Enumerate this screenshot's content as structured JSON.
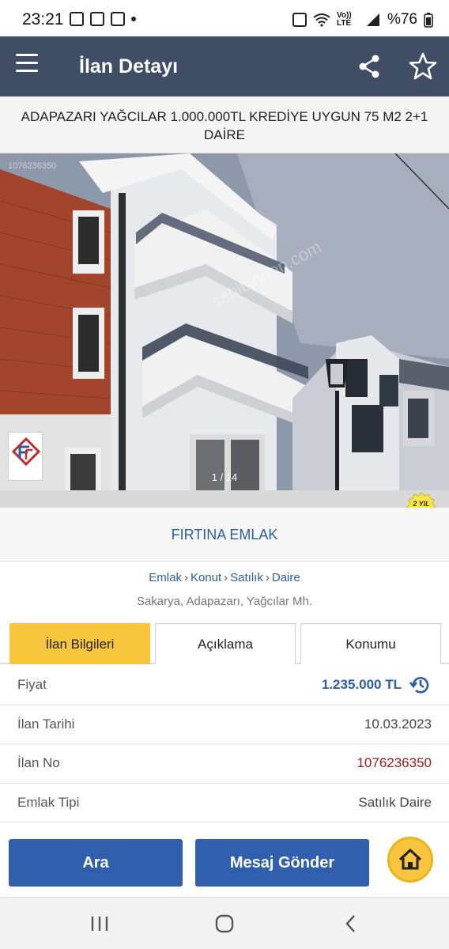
{
  "status_bar": {
    "time": "23:21",
    "battery": "%76",
    "network": "Vo)) LTE"
  },
  "app_bar": {
    "title": "İlan Detayı"
  },
  "listing": {
    "title": "ADAPAZARI YAĞCILAR 1.000.000TL KREDİYE UYGUN 75 M2 2+1 DAİRE",
    "photo_counter": "1 / 14",
    "watermark": "sahibinden.com",
    "image_id_text": "1076236350"
  },
  "badge": {
    "text": "2 YIL"
  },
  "agency": {
    "name": "FIRTINA EMLAK"
  },
  "breadcrumb": [
    "Emlak",
    "Konut",
    "Satılık",
    "Daire"
  ],
  "location": "Sakarya, Adapazarı, Yağcılar Mh.",
  "tabs": [
    {
      "label": "İlan Bilgileri",
      "active": true
    },
    {
      "label": "Açıklama",
      "active": false
    },
    {
      "label": "Konumu",
      "active": false
    }
  ],
  "info": [
    {
      "key": "Fiyat",
      "value": "1.235.000 TL"
    },
    {
      "key": "İlan Tarihi",
      "value": "10.03.2023"
    },
    {
      "key": "İlan No",
      "value": "1076236350"
    },
    {
      "key": "Emlak Tipi",
      "value": "Satılık Daire"
    }
  ],
  "actions": {
    "call": "Ara",
    "message": "Mesaj Gönder"
  },
  "colors": {
    "appbar": "#3f4e64",
    "accent_yellow": "#f7c63d",
    "link_blue": "#2a5ea7",
    "button_blue": "#2f5fad",
    "listing_no_red": "#a01a1a"
  }
}
